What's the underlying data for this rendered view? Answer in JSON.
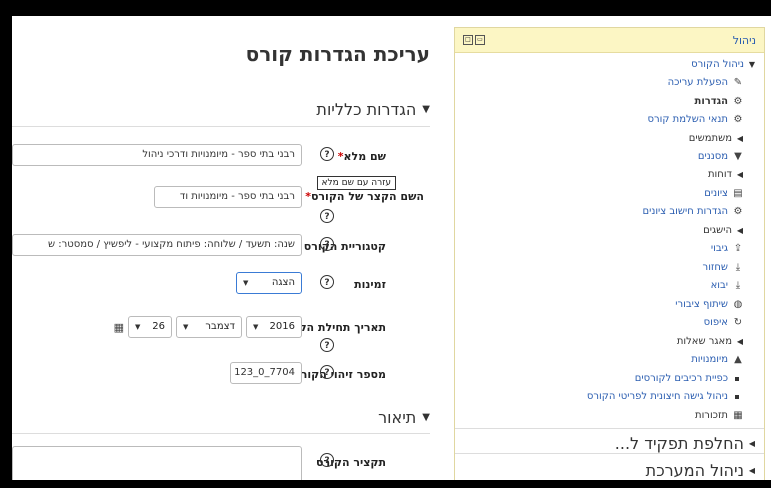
{
  "page": {
    "title": "עריכת הגדרות קורס",
    "section_general": "הגדרות כלליות",
    "section_description": "תיאור"
  },
  "form": {
    "fullname": {
      "label": "שם מלא",
      "value": "רבני בתי ספר - מיומנויות ודרכי ניהול"
    },
    "shortname": {
      "label": "השם הקצר של הקורס",
      "value": "רבני בתי ספר - מיומנויות וד"
    },
    "tooltip": "עזרה עם שם מלא",
    "category": {
      "label": "קטגוריית הקורס",
      "value": "שנה: תשעד / שלוחה: פיתוח מקצועי - ליפשיץ / סמסטר: ש"
    },
    "visibility": {
      "label": "זמינות",
      "value": "הצגה"
    },
    "startdate": {
      "label": "תאריך תחילת הקורס",
      "year": "2016",
      "month": "דצמבר",
      "day": "26"
    },
    "idnumber": {
      "label": "מספר זיהוי הקורס",
      "value": "7704_0_123"
    },
    "summary": {
      "label": "תקציר הקורס"
    },
    "required_mark": "*",
    "help_symbol": "?"
  },
  "panel": {
    "title": "ניהול",
    "items": [
      {
        "label": "ניהול הקורס",
        "icon": "expanded-triangle-icon"
      },
      {
        "label": "הפעלת עריכה",
        "icon": "pencil-icon"
      },
      {
        "label": "הגדרות",
        "icon": "gear-icon"
      },
      {
        "label": "תנאי השלמת קורס",
        "icon": "gear-icon"
      },
      {
        "label": "משתמשים",
        "icon": "collapsed-triangle-icon"
      },
      {
        "label": "מסננים",
        "icon": "filter-icon"
      },
      {
        "label": "דוחות",
        "icon": "collapsed-triangle-icon"
      },
      {
        "label": "ציונים",
        "icon": "grades-table-icon"
      },
      {
        "label": "הגדרות חישוב ציונים",
        "icon": "gear-icon"
      },
      {
        "label": "הישגים",
        "icon": "collapsed-triangle-icon"
      },
      {
        "label": "גיבוי",
        "icon": "upload-icon"
      },
      {
        "label": "שחזור",
        "icon": "download-icon"
      },
      {
        "label": "יבוא",
        "icon": "download-icon"
      },
      {
        "label": "שיתוף ציבורי",
        "icon": "globe-icon"
      },
      {
        "label": "איפוס",
        "icon": "reset-icon"
      },
      {
        "label": "מאגר שאלות",
        "icon": "collapsed-triangle-icon"
      },
      {
        "label": "מיומנויות",
        "icon": "skills-icon"
      },
      {
        "label": "כפיית רכיבים לקורסים",
        "icon": "bullet-icon"
      },
      {
        "label": "ניהול גישה חיצונית לפריטי הקורס",
        "icon": "bullet-icon"
      },
      {
        "label": "תזכורות",
        "icon": "calendar-icon"
      },
      {
        "label": "החלפת תפקיד ל...",
        "icon": "collapsed-triangle-icon"
      },
      {
        "label": "ניהול המערכת",
        "icon": "collapsed-triangle-icon"
      }
    ]
  }
}
